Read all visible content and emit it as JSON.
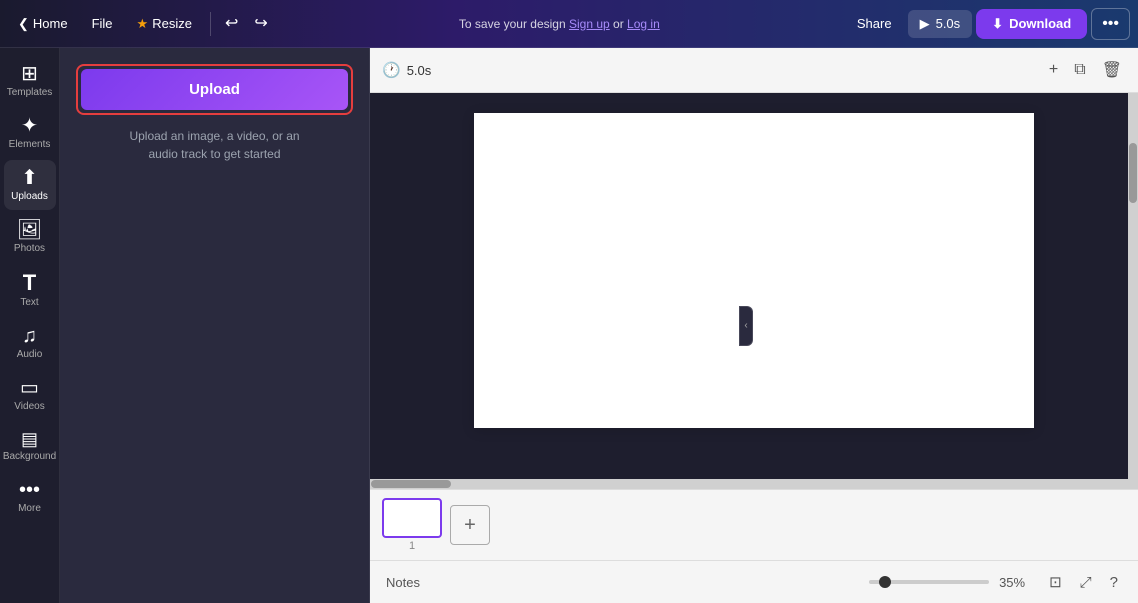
{
  "topnav": {
    "home_label": "Home",
    "file_label": "File",
    "resize_label": "Resize",
    "undo_icon": "↩",
    "redo_icon": "↪",
    "save_hint": "To save your design",
    "signup_label": "Sign up",
    "or_text": " or ",
    "login_label": "Log in",
    "share_label": "Share",
    "play_duration": "5.0s",
    "download_label": "Download",
    "more_icon": "•••"
  },
  "sidebar": {
    "items": [
      {
        "id": "templates",
        "icon": "⊞",
        "label": "Templates"
      },
      {
        "id": "elements",
        "icon": "✦",
        "label": "Elements"
      },
      {
        "id": "uploads",
        "icon": "⬆",
        "label": "Uploads"
      },
      {
        "id": "photos",
        "icon": "🖼",
        "label": "Photos"
      },
      {
        "id": "text",
        "icon": "T",
        "label": "Text"
      },
      {
        "id": "audio",
        "icon": "♫",
        "label": "Audio"
      },
      {
        "id": "videos",
        "icon": "▭",
        "label": "Videos"
      },
      {
        "id": "background",
        "icon": "▤",
        "label": "Background"
      },
      {
        "id": "more",
        "icon": "•••",
        "label": "More"
      }
    ]
  },
  "panel": {
    "upload_button_label": "Upload",
    "upload_hint": "Upload an image, a video, or an\naudio track to get started"
  },
  "canvas": {
    "time_label": "5.0s",
    "add_icon": "+",
    "duplicate_icon": "⧉",
    "delete_icon": "🗑"
  },
  "filmstrip": {
    "pages": [
      {
        "number": "1"
      }
    ],
    "add_label": "+"
  },
  "notes_bar": {
    "label": "Notes",
    "slider_pct": "35%",
    "fit_icon": "⊡",
    "expand_icon": "⤢",
    "help_icon": "?"
  },
  "collapse_handle": {
    "icon": "‹"
  }
}
